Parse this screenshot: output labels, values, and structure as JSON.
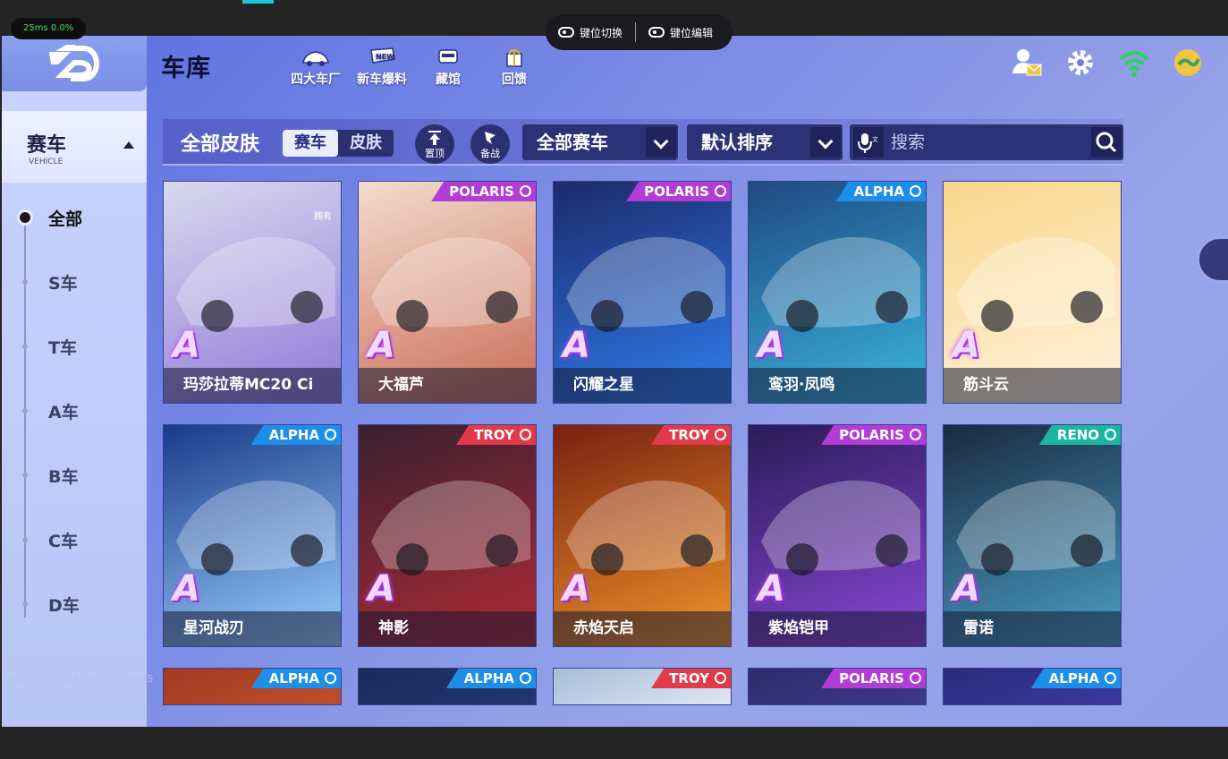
{
  "overlay": {
    "perf": "25ms  0.0%",
    "key_switch": "键位切换",
    "key_edit": "键位编辑",
    "stamp": "08/29 13:12:24 UID:13826495"
  },
  "header": {
    "title": "车库",
    "nav": [
      {
        "label": "四大车厂",
        "icon": "car-factory-icon"
      },
      {
        "label": "新车爆料",
        "icon": "new-badge-icon"
      },
      {
        "label": "藏馆",
        "icon": "car-collection-icon"
      },
      {
        "label": "回馈",
        "icon": "gift-icon"
      }
    ],
    "right_icons": [
      "friends-mail-icon",
      "gear-icon",
      "wifi-icon",
      "currency-icon"
    ]
  },
  "sidebar": {
    "category": "赛车",
    "category_en": "VEHICLE",
    "filters": [
      "全部",
      "S车",
      "T车",
      "A车",
      "B车",
      "C车",
      "D车"
    ],
    "active_filter": "全部"
  },
  "toolbar": {
    "all_skins": "全部皮肤",
    "seg_car": "赛车",
    "seg_skin": "皮肤",
    "pin_top": "置顶",
    "backup": "备战",
    "car_filter": "全部赛车",
    "sort": "默认排序",
    "search_placeholder": "搜索"
  },
  "cards": [
    {
      "name": "玛莎拉蒂MC20 Ci",
      "rank": "A",
      "brand": "",
      "owned": "拥有",
      "colors": [
        "#d9d9ee",
        "#8f78d8"
      ]
    },
    {
      "name": "大福芦",
      "rank": "A",
      "brand": "POLARIS",
      "colors": [
        "#f3dccd",
        "#c96b55"
      ]
    },
    {
      "name": "闪耀之星",
      "rank": "A",
      "brand": "POLARIS",
      "colors": [
        "#1c2a6a",
        "#2f7ff0"
      ]
    },
    {
      "name": "鸾羽·凤鸣",
      "rank": "A",
      "brand": "ALPHA",
      "colors": [
        "#1f4a80",
        "#3bb5e0"
      ]
    },
    {
      "name": "筋斗云",
      "rank": "A",
      "brand": "",
      "colors": [
        "#f9d68a",
        "#fff3de"
      ]
    },
    {
      "name": "星河战刃",
      "rank": "A",
      "brand": "ALPHA",
      "colors": [
        "#1a3b8a",
        "#9ad0ff"
      ]
    },
    {
      "name": "神影",
      "rank": "A",
      "brand": "TROY",
      "colors": [
        "#3a2030",
        "#b22a36"
      ]
    },
    {
      "name": "赤焰天启",
      "rank": "A",
      "brand": "TROY",
      "colors": [
        "#7a2010",
        "#f0962a"
      ]
    },
    {
      "name": "紫焰铠甲",
      "rank": "A",
      "brand": "POLARIS",
      "colors": [
        "#2a1b58",
        "#8c48d8"
      ]
    },
    {
      "name": "雷诺",
      "rank": "A",
      "brand": "RENO",
      "colors": [
        "#1a2a40",
        "#4aa0c8"
      ]
    }
  ],
  "partial_cards": [
    {
      "brand": "ALPHA",
      "colors": [
        "#a23a22",
        "#c04e2c"
      ]
    },
    {
      "brand": "ALPHA",
      "colors": [
        "#1a2a5a",
        "#24366e"
      ]
    },
    {
      "brand": "TROY",
      "colors": [
        "#a8bcd8",
        "#dfe7f2"
      ]
    },
    {
      "brand": "POLARIS",
      "colors": [
        "#2e2a6a",
        "#3c3a8a"
      ]
    },
    {
      "brand": "ALPHA",
      "colors": [
        "#2a2a7a",
        "#3a3aa0"
      ]
    }
  ]
}
